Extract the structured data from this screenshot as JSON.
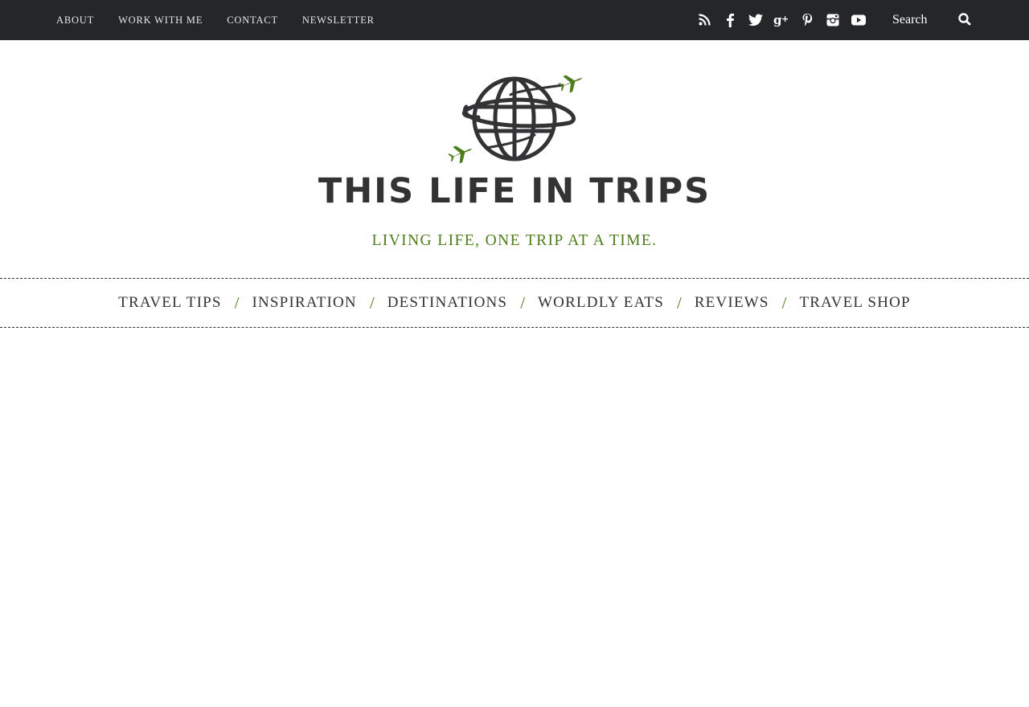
{
  "topbar": {
    "links": [
      "ABOUT",
      "WORK WITH ME",
      "CONTACT",
      "NEWSLETTER"
    ],
    "social_icons": [
      "rss-icon",
      "facebook-icon",
      "twitter-icon",
      "google-plus-icon",
      "pinterest-icon",
      "instagram-icon",
      "youtube-icon"
    ],
    "search_placeholder": "Search"
  },
  "header": {
    "site_title": "THIS LIFE IN TRIPS",
    "tagline": "LIVING LIFE, ONE TRIP AT A TIME."
  },
  "main_nav": {
    "items": [
      "TRAVEL TIPS",
      "INSPIRATION",
      "DESTINATIONS",
      "WORLDLY EATS",
      "REVIEWS",
      "TRAVEL SHOP"
    ],
    "separator": "/"
  },
  "colors": {
    "topbar_bg": "#252628",
    "accent_green": "#4e7d1c",
    "logo_dark": "#333335"
  }
}
